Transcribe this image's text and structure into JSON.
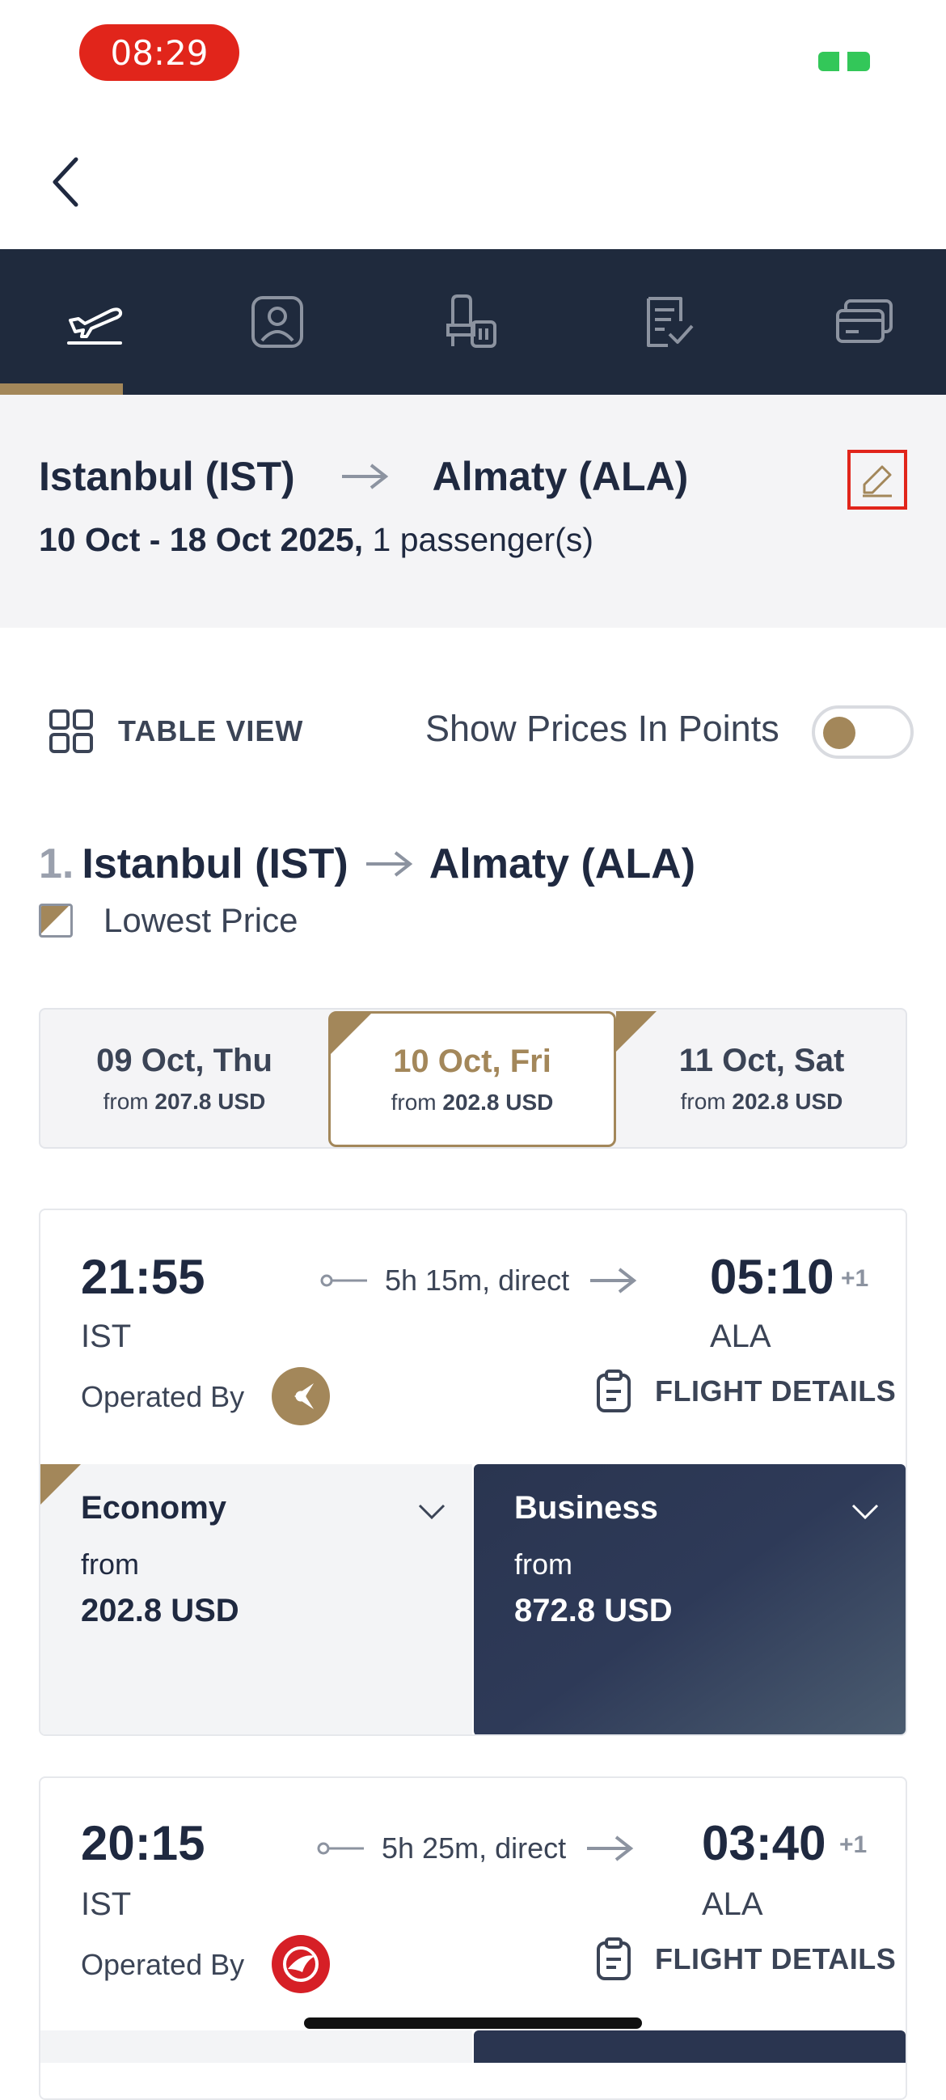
{
  "status_bar": {
    "time": "08:29"
  },
  "summary": {
    "origin": "Istanbul (IST)",
    "destination": "Almaty (ALA)",
    "dates": "10 Oct - 18 Oct 2025,",
    "passengers": " 1 passenger(s)"
  },
  "controls": {
    "table_view": "TABLE VIEW",
    "show_points": "Show Prices In Points",
    "points_enabled": false
  },
  "leg": {
    "number": "1.",
    "origin": "Istanbul (IST)",
    "destination": "Almaty (ALA)",
    "lowest_price_label": "Lowest Price"
  },
  "dates": [
    {
      "day": "09 Oct, Thu",
      "from": "from",
      "price": "207.8 USD"
    },
    {
      "day": "10 Oct, Fri",
      "from": "from",
      "price": "202.8 USD"
    },
    {
      "day": "11 Oct, Sat",
      "from": "from",
      "price": "202.8 USD"
    }
  ],
  "flights": [
    {
      "dep_time": "21:55",
      "dep_code": "IST",
      "duration": "5h 15m, direct",
      "arr_time": "05:10",
      "arr_plus": "+1",
      "arr_code": "ALA",
      "operated_by": "Operated By",
      "details": "FLIGHT DETAILS",
      "economy": {
        "name": "Economy",
        "from": "from",
        "price": "202.8 USD"
      },
      "business": {
        "name": "Business",
        "from": "from",
        "price": "872.8 USD"
      }
    },
    {
      "dep_time": "20:15",
      "dep_code": "IST",
      "duration": "5h 25m, direct",
      "arr_time": "03:40",
      "arr_plus": "+1",
      "arr_code": "ALA",
      "operated_by": "Operated By",
      "details": "FLIGHT DETAILS"
    }
  ],
  "colors": {
    "brand_gold": "#a3875a",
    "navy": "#1f2a3d",
    "highlight_red": "#e1251b"
  },
  "icons": [
    "back-chevron-icon",
    "plane-icon",
    "passenger-icon",
    "seat-luggage-icon",
    "checklist-icon",
    "payment-card-icon",
    "edit-pencil-icon",
    "grid-icon",
    "arrow-right-icon",
    "clipboard-icon",
    "chevron-down-icon"
  ]
}
